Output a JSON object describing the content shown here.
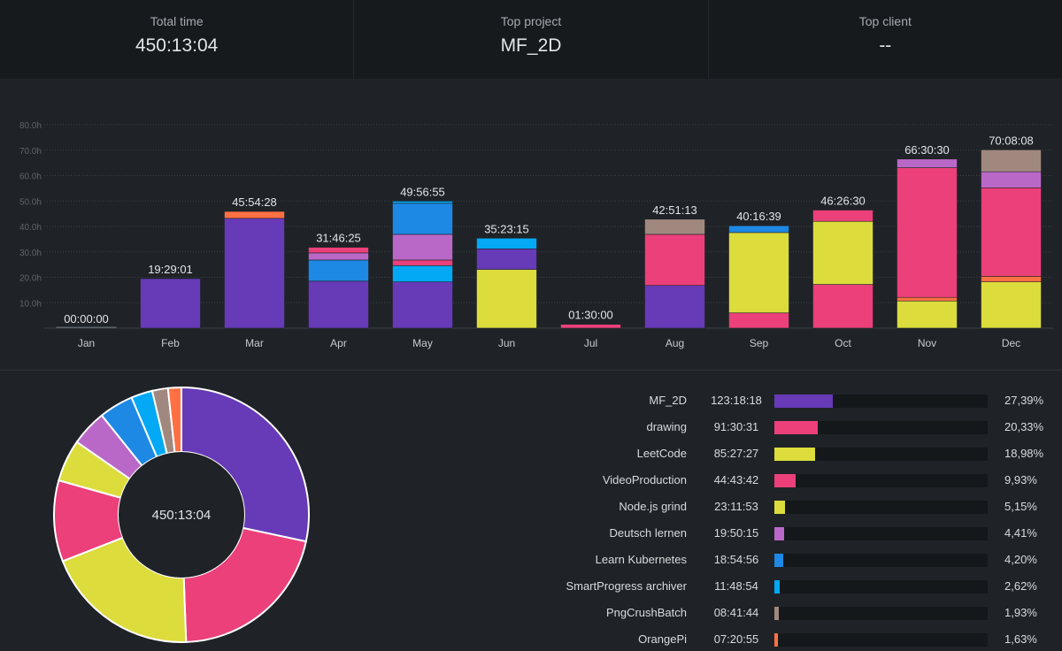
{
  "summary": {
    "total_time": {
      "label": "Total time",
      "value": "450:13:04"
    },
    "top_project": {
      "label": "Top project",
      "value": "MF_2D"
    },
    "top_client": {
      "label": "Top client",
      "value": "--"
    }
  },
  "colors": {
    "MF_2D": "#673ab7",
    "drawing": "#ec407a",
    "LeetCode": "#dcdc3c",
    "VideoProduction": "#ec407a",
    "Node.js grind": "#dcdc3c",
    "Deutsch lernen": "#ba68c8",
    "Learn Kubernetes": "#1e88e5",
    "SmartProgress archiver": "#03a9f4",
    "PngCrushBatch": "#a1887f",
    "OrangePi": "#ff7043"
  },
  "chart_data": [
    {
      "type": "bar",
      "stacked": true,
      "categories": [
        "Jan",
        "Feb",
        "Mar",
        "Apr",
        "May",
        "Jun",
        "Jul",
        "Aug",
        "Sep",
        "Oct",
        "Nov",
        "Dec"
      ],
      "ylim": [
        0,
        80
      ],
      "yticks": [
        "10.0h",
        "20.0h",
        "30.0h",
        "40.0h",
        "50.0h",
        "60.0h",
        "70.0h",
        "80.0h"
      ],
      "grid": true,
      "totals": [
        "00:00:00",
        "19:29:01",
        "45:54:28",
        "31:46:25",
        "49:56:55",
        "35:23:15",
        "01:30:00",
        "42:51:13",
        "40:16:39",
        "46:26:30",
        "66:30:30",
        "70:08:08"
      ],
      "stacks": [
        [],
        [
          {
            "project": "MF_2D",
            "value": 19.48
          }
        ],
        [
          {
            "project": "MF_2D",
            "value": 43.2
          },
          {
            "project": "OrangePi",
            "value": 2.7
          }
        ],
        [
          {
            "project": "MF_2D",
            "value": 18.5
          },
          {
            "project": "Learn Kubernetes",
            "value": 8.3
          },
          {
            "project": "Deutsch lernen",
            "value": 2.8
          },
          {
            "project": "VideoProduction",
            "value": 2.2
          }
        ],
        [
          {
            "project": "MF_2D",
            "value": 18.2
          },
          {
            "project": "SmartProgress archiver",
            "value": 6.4
          },
          {
            "project": "VideoProduction",
            "value": 2.2
          },
          {
            "project": "Deutsch lernen",
            "value": 10.1
          },
          {
            "project": "Learn Kubernetes",
            "value": 12.2
          },
          {
            "project": "SmartProgress archiver",
            "value": 0.85
          }
        ],
        [
          {
            "project": "LeetCode",
            "value": 23.1
          },
          {
            "project": "MF_2D",
            "value": 8.1
          },
          {
            "project": "SmartProgress archiver",
            "value": 4.19
          }
        ],
        [
          {
            "project": "drawing",
            "value": 1.5
          }
        ],
        [
          {
            "project": "MF_2D",
            "value": 16.8
          },
          {
            "project": "drawing",
            "value": 20.1
          },
          {
            "project": "PngCrushBatch",
            "value": 5.95
          }
        ],
        [
          {
            "project": "drawing",
            "value": 6.0
          },
          {
            "project": "LeetCode",
            "value": 31.6
          },
          {
            "project": "Learn Kubernetes",
            "value": 2.68
          }
        ],
        [
          {
            "project": "drawing",
            "value": 17.2
          },
          {
            "project": "LeetCode",
            "value": 24.8
          },
          {
            "project": "VideoProduction",
            "value": 4.44
          }
        ],
        [
          {
            "project": "LeetCode",
            "value": 10.7
          },
          {
            "project": "OrangePi",
            "value": 1.4
          },
          {
            "project": "drawing",
            "value": 51.0
          },
          {
            "project": "Deutsch lernen",
            "value": 3.41
          }
        ],
        [
          {
            "project": "LeetCode",
            "value": 18.2
          },
          {
            "project": "OrangePi",
            "value": 2.2
          },
          {
            "project": "drawing",
            "value": 34.8
          },
          {
            "project": "Deutsch lernen",
            "value": 6.3
          },
          {
            "project": "PngCrushBatch",
            "value": 8.64
          }
        ]
      ]
    },
    {
      "type": "pie",
      "donut": true,
      "center_label": "450:13:04",
      "slices": [
        {
          "name": "MF_2D",
          "time": "123:18:18",
          "percent": "27,39%",
          "value": 27.39
        },
        {
          "name": "drawing",
          "time": "91:30:31",
          "percent": "20,33%",
          "value": 20.33
        },
        {
          "name": "LeetCode",
          "time": "85:27:27",
          "percent": "18,98%",
          "value": 18.98
        },
        {
          "name": "VideoProduction",
          "time": "44:43:42",
          "percent": "9,93%",
          "value": 9.93
        },
        {
          "name": "Node.js grind",
          "time": "23:11:53",
          "percent": "5,15%",
          "value": 5.15
        },
        {
          "name": "Deutsch lernen",
          "time": "19:50:15",
          "percent": "4,41%",
          "value": 4.41
        },
        {
          "name": "Learn Kubernetes",
          "time": "18:54:56",
          "percent": "4,20%",
          "value": 4.2
        },
        {
          "name": "SmartProgress archiver",
          "time": "11:48:54",
          "percent": "2,62%",
          "value": 2.62
        },
        {
          "name": "PngCrushBatch",
          "time": "08:41:44",
          "percent": "1,93%",
          "value": 1.93
        },
        {
          "name": "OrangePi",
          "time": "07:20:55",
          "percent": "1,63%",
          "value": 1.63
        }
      ]
    }
  ]
}
